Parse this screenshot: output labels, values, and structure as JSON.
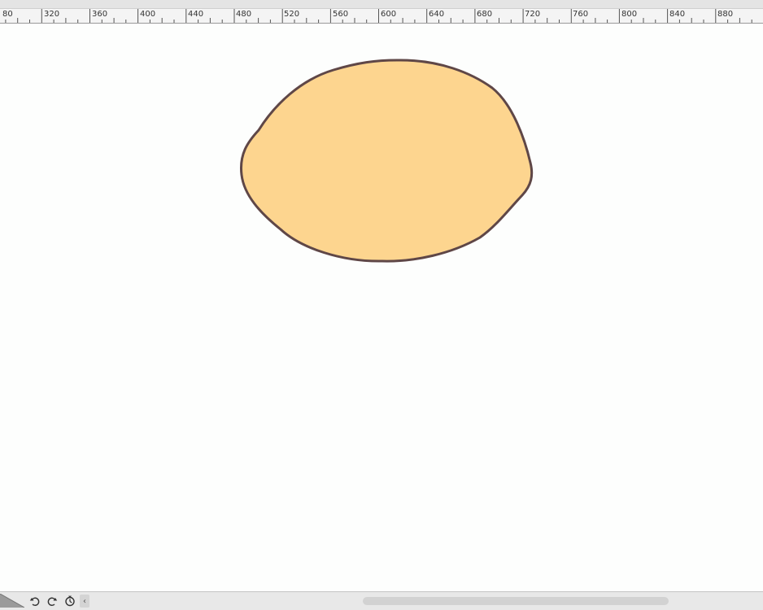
{
  "ruler": {
    "labels": [
      "80",
      "320",
      "360",
      "400",
      "440",
      "480",
      "520",
      "560",
      "600",
      "640",
      "680",
      "720",
      "760",
      "800",
      "840",
      "880"
    ]
  },
  "canvas": {
    "shape_fill": "#fdd58f",
    "shape_stroke": "#5f4747"
  },
  "bottom_bar": {
    "icons": [
      "undo-icon",
      "redo-icon",
      "history-icon",
      "chevron-left-icon"
    ],
    "scroll_left_glyph": "‹"
  },
  "colors": {
    "canvas_bg": "#fdfefd",
    "ruler_bg": "#f4f4f4",
    "toolbar_bg": "#e8e8e8"
  }
}
